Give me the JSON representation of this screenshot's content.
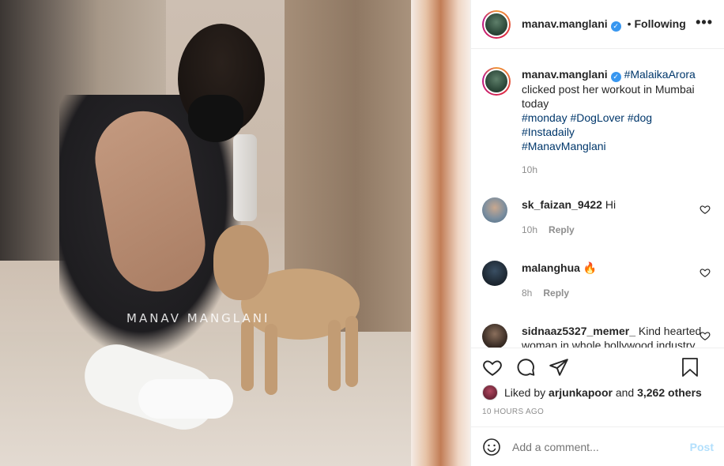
{
  "photo": {
    "watermark": "MANAV MANGLANI"
  },
  "header": {
    "username": "manav.manglani",
    "separator": "•",
    "follow_status": "Following",
    "more_icon": "more-horizontal-icon"
  },
  "caption": {
    "username": "manav.manglani",
    "mention": "#MalaikaArora",
    "text": " clicked post her workout in Mumbai today",
    "hashtags": [
      "#monday",
      "#DogLover",
      "#dog",
      "#Instadaily",
      "#ManavManglani"
    ],
    "time": "10h"
  },
  "comments": [
    {
      "username": "sk_faizan_9422",
      "text": "Hi",
      "time": "10h",
      "reply": "Reply"
    },
    {
      "username": "malanghua",
      "text": "🔥",
      "time": "8h",
      "reply": "Reply"
    },
    {
      "username": "sidnaaz5327_memer_",
      "text": "Kind hearted woman in whole bollywood industry🤩🤩❤️",
      "time": "",
      "reply": ""
    }
  ],
  "likes": {
    "prefix": "Liked by",
    "user": "arjunkapoor",
    "conjunction": "and",
    "others": "3,262 others"
  },
  "time_ago": "10 HOURS AGO",
  "add_comment": {
    "placeholder": "Add a comment...",
    "post_label": "Post"
  },
  "colors": {
    "link": "#00376b",
    "verified": "#3897f0",
    "muted": "#8e8e8e",
    "post_disabled": "#b2dffc"
  }
}
